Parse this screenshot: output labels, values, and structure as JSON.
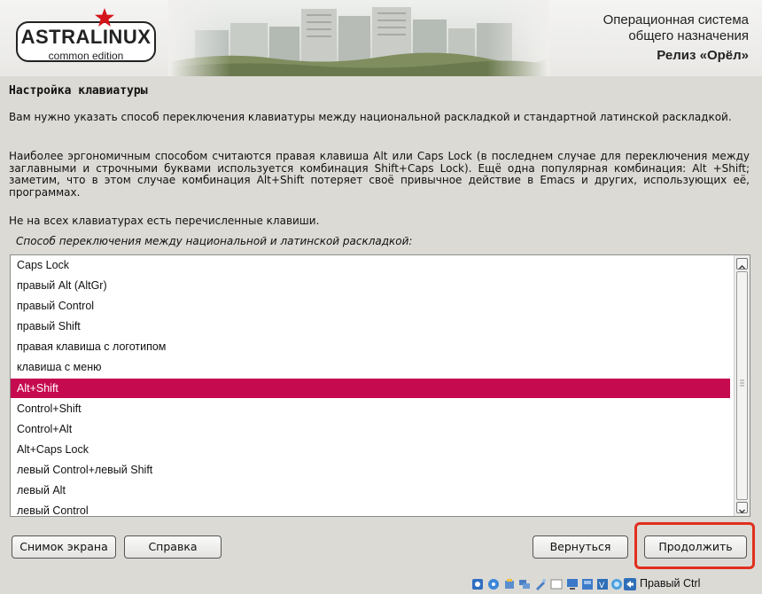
{
  "header": {
    "logo_text": "ASTRALINUX",
    "logo_sub": "common edition",
    "line1": "Операционная система",
    "line2": "общего назначения",
    "release": "Релиз «Орёл»"
  },
  "page": {
    "title": "Настройка клавиатуры",
    "paragraphs": [
      "Вам нужно указать способ переключения клавиатуры между национальной раскладкой и стандартной латинской раскладкой.",
      "Наиболее эргономичным способом считаются правая клавиша Alt или Caps Lock (в последнем случае для переключения между заглавными и строчными буквами используется комбинация Shift+Caps Lock). Ещё одна популярная комбинация: Alt +Shift; заметим, что в этом случае комбинация Alt+Shift потеряет своё привычное действие в Emacs и других, использующих её, программах.",
      "Не на всех клавиатурах есть перечисленные клавиши."
    ],
    "prompt": "Способ переключения между национальной и латинской раскладкой:"
  },
  "list": {
    "selected_index": 6,
    "items": [
      "Caps Lock",
      "правый Alt (AltGr)",
      "правый Control",
      "правый Shift",
      "правая клавиша с логотипом",
      "клавиша с меню",
      "Alt+Shift",
      "Control+Shift",
      "Control+Alt",
      "Alt+Caps Lock",
      "левый Control+левый Shift",
      "левый Alt",
      "левый Control"
    ]
  },
  "buttons": {
    "screenshot": "Снимок экрана",
    "help": "Справка",
    "back": "Вернуться",
    "continue": "Продолжить"
  },
  "taskbar": {
    "host_key": "Правый Ctrl",
    "icons": [
      "disk-icon",
      "optical-drive-icon",
      "audio-icon",
      "network-icon",
      "usb-icon",
      "shared-folder-icon",
      "display-icon",
      "recording-icon",
      "cpu-icon",
      "mouse-integration-icon",
      "host-key-arrow-icon"
    ]
  },
  "colors": {
    "selection": "#c50a50",
    "highlight_frame": "#e0301e"
  }
}
